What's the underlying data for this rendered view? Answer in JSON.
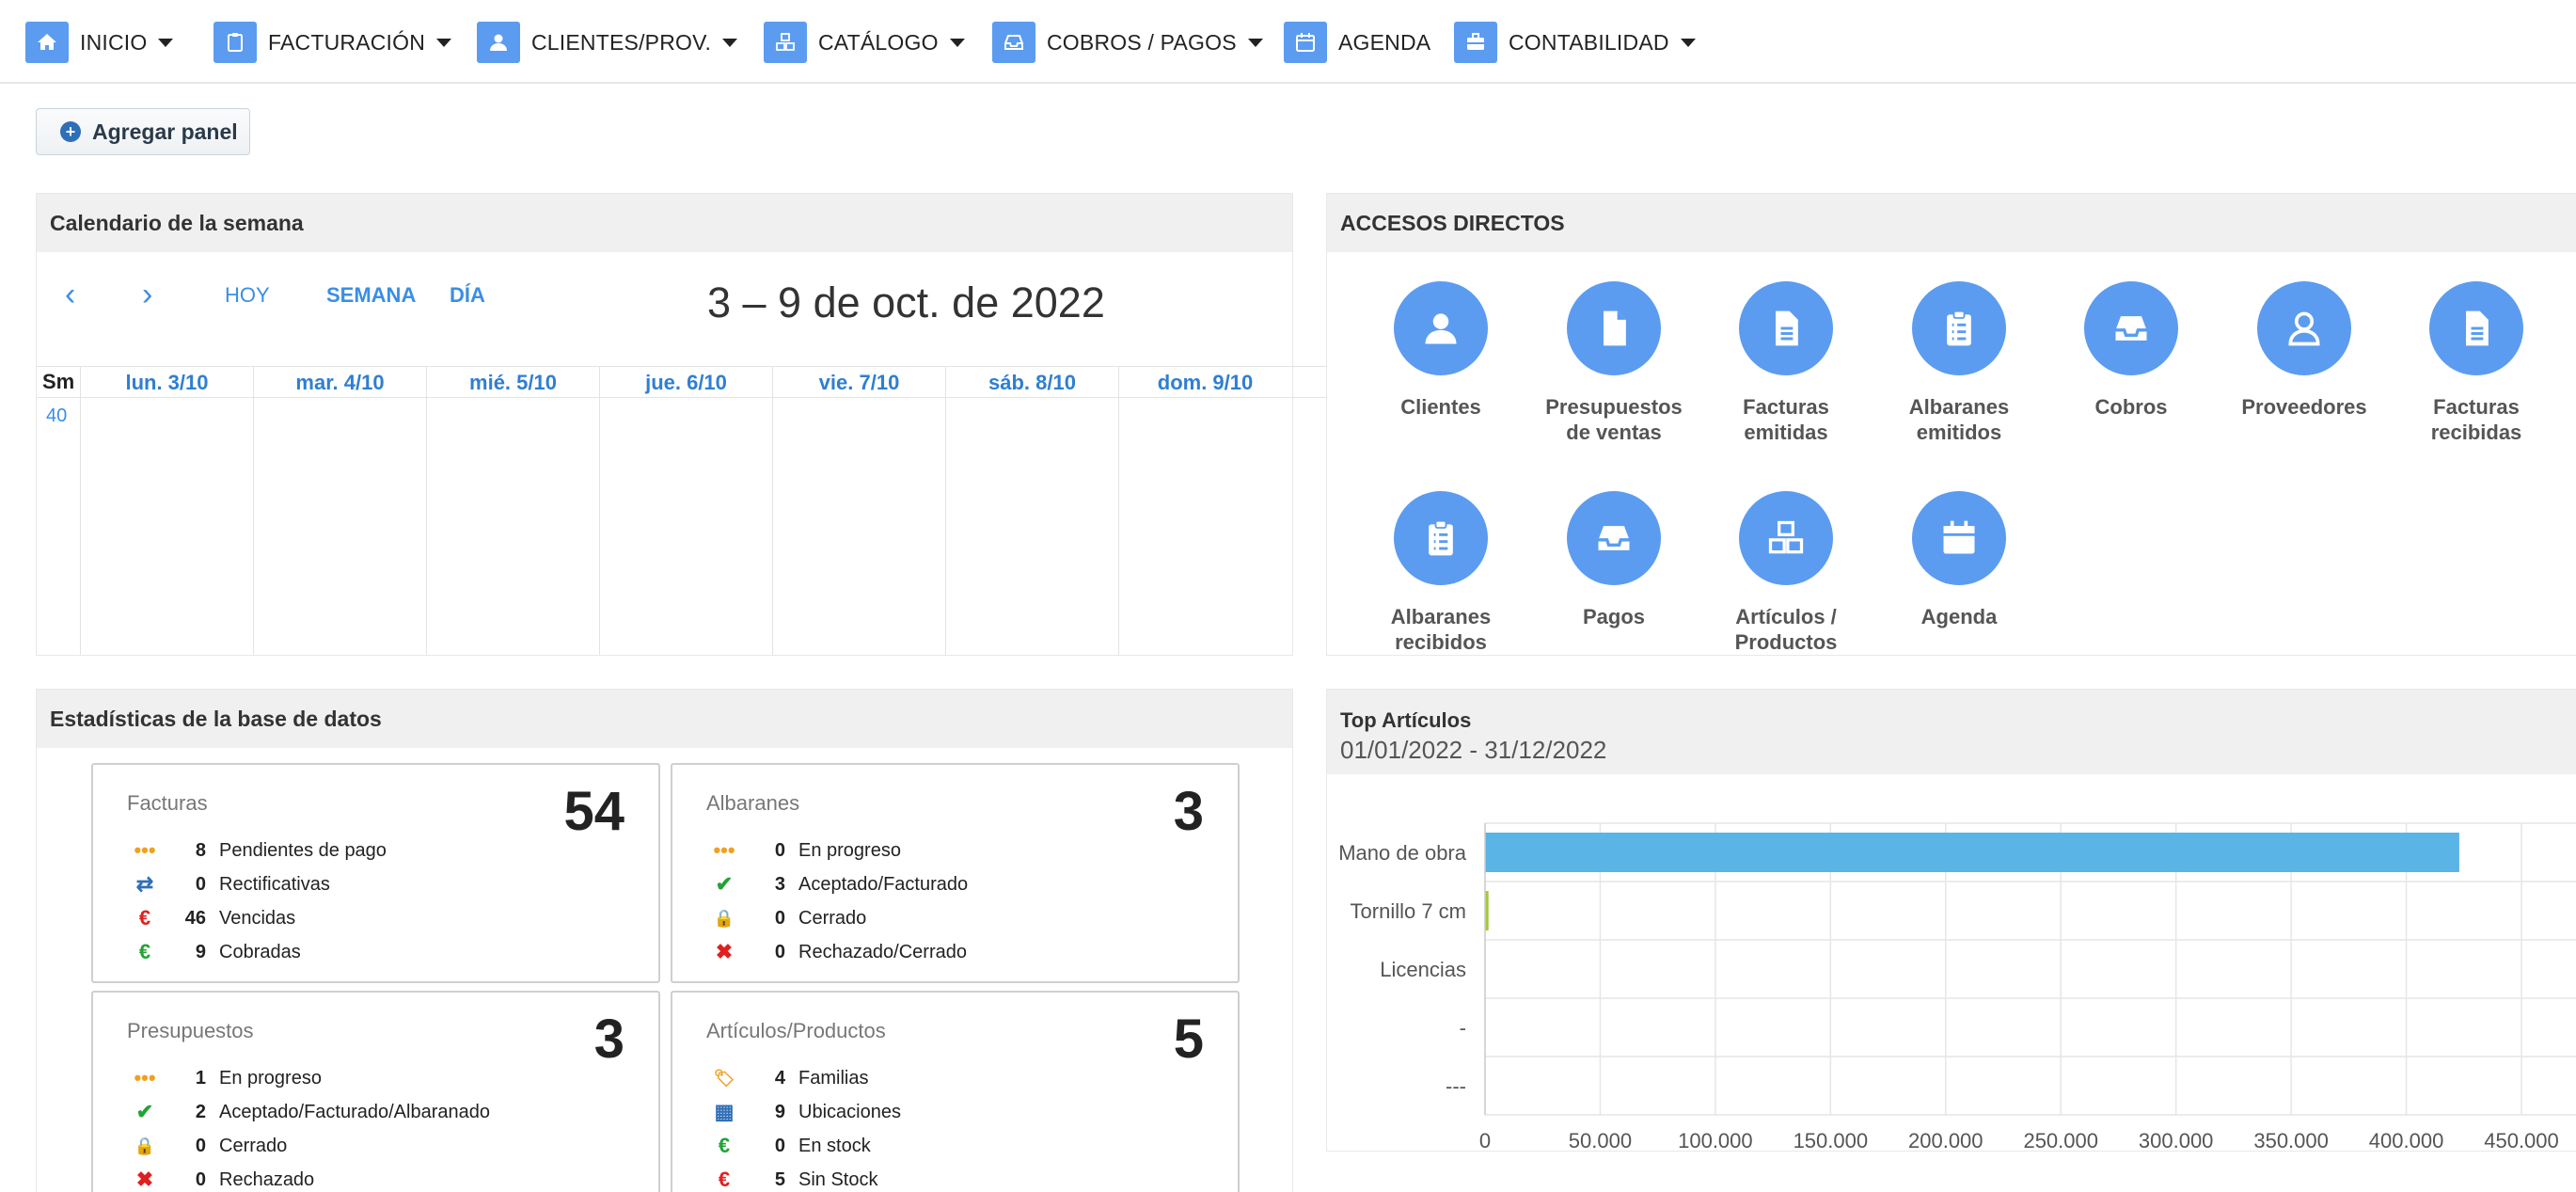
{
  "nav": {
    "items": [
      {
        "label": "INICIO",
        "icon": "home-icon",
        "caret": true
      },
      {
        "label": "FACTURACIÓN",
        "icon": "clipboard-icon",
        "caret": true
      },
      {
        "label": "CLIENTES/PROV.",
        "icon": "user-icon",
        "caret": true
      },
      {
        "label": "CATÁLOGO",
        "icon": "cubes-icon",
        "caret": true
      },
      {
        "label": "COBROS / PAGOS",
        "icon": "inbox-icon",
        "caret": true
      },
      {
        "label": "AGENDA",
        "icon": "calendar-icon",
        "caret": false
      },
      {
        "label": "CONTABILIDAD",
        "icon": "briefcase-icon",
        "caret": true
      }
    ],
    "accent": "#5b9cf0"
  },
  "toolbar": {
    "add_panel_label": "Agregar panel"
  },
  "calendar": {
    "title": "Calendario de la semana",
    "prev": "‹",
    "next": "›",
    "today": "HOY",
    "week": "SEMANA",
    "day": "DÍA",
    "range": "3 – 9 de oct. de 2022",
    "week_header": "Sm",
    "week_number": "40",
    "days": [
      "lun. 3/10",
      "mar. 4/10",
      "mié. 5/10",
      "jue. 6/10",
      "vie. 7/10",
      "sáb. 8/10",
      "dom. 9/10"
    ]
  },
  "accesos": {
    "title": "ACCESOS DIRECTOS",
    "items": [
      {
        "label1": "Clientes",
        "label2": "",
        "icon": "user-icon"
      },
      {
        "label1": "Presupuestos",
        "label2": "de ventas",
        "icon": "file-icon"
      },
      {
        "label1": "Facturas",
        "label2": "emitidas",
        "icon": "file-text-icon"
      },
      {
        "label1": "Albaranes",
        "label2": "emitidos",
        "icon": "clipboard-list-icon"
      },
      {
        "label1": "Cobros",
        "label2": "",
        "icon": "inbox-icon"
      },
      {
        "label1": "Proveedores",
        "label2": "",
        "icon": "user-outline-icon"
      },
      {
        "label1": "Facturas",
        "label2": "recibidas",
        "icon": "file-text-icon"
      },
      {
        "label1": "Albaranes",
        "label2": "recibidos",
        "icon": "clipboard-list-icon"
      },
      {
        "label1": "Pagos",
        "label2": "",
        "icon": "inbox-icon"
      },
      {
        "label1": "Artículos /",
        "label2": "Productos",
        "icon": "cubes-icon"
      },
      {
        "label1": "Agenda",
        "label2": "",
        "icon": "calendar-icon"
      }
    ]
  },
  "stats": {
    "title": "Estadísticas de la base de datos",
    "cards": [
      {
        "title": "Facturas",
        "total": "54",
        "rows": [
          {
            "icon": "ellipsis-icon",
            "glyph": "•••",
            "color": "#f0a020",
            "n": "8",
            "label": "Pendientes de pago"
          },
          {
            "icon": "exchange-icon",
            "glyph": "⇄",
            "color": "#2f6fb8",
            "n": "0",
            "label": "Rectificativas"
          },
          {
            "icon": "euro-icon",
            "glyph": "€",
            "color": "#e02020",
            "n": "46",
            "label": "Vencidas"
          },
          {
            "icon": "euro-icon",
            "glyph": "€",
            "color": "#22a335",
            "n": "9",
            "label": "Cobradas"
          }
        ]
      },
      {
        "title": "Albaranes",
        "total": "3",
        "rows": [
          {
            "icon": "ellipsis-icon",
            "glyph": "•••",
            "color": "#f0a020",
            "n": "0",
            "label": "En progreso"
          },
          {
            "icon": "check-icon",
            "glyph": "✔",
            "color": "#22a335",
            "n": "3",
            "label": "Aceptado/Facturado"
          },
          {
            "icon": "lock-icon",
            "glyph": "🔒",
            "color": "#2f6fb8",
            "n": "0",
            "label": "Cerrado"
          },
          {
            "icon": "times-icon",
            "glyph": "✖",
            "color": "#e02020",
            "n": "0",
            "label": "Rechazado/Cerrado"
          }
        ]
      },
      {
        "title": "Presupuestos",
        "total": "3",
        "rows": [
          {
            "icon": "ellipsis-icon",
            "glyph": "•••",
            "color": "#f0a020",
            "n": "1",
            "label": "En progreso"
          },
          {
            "icon": "check-icon",
            "glyph": "✔",
            "color": "#22a335",
            "n": "2",
            "label": "Aceptado/Facturado/Albaranado"
          },
          {
            "icon": "lock-icon",
            "glyph": "🔒",
            "color": "#2f6fb8",
            "n": "0",
            "label": "Cerrado"
          },
          {
            "icon": "times-icon",
            "glyph": "✖",
            "color": "#e02020",
            "n": "0",
            "label": "Rechazado"
          }
        ]
      },
      {
        "title": "Artículos/Productos",
        "total": "5",
        "rows": [
          {
            "icon": "tag-icon",
            "glyph": "🏷",
            "color": "#f0a020",
            "n": "4",
            "label": "Familias"
          },
          {
            "icon": "cubes-icon",
            "glyph": "▦",
            "color": "#2f6fb8",
            "n": "9",
            "label": "Ubicaciones"
          },
          {
            "icon": "euro-icon",
            "glyph": "€",
            "color": "#22a335",
            "n": "0",
            "label": "En stock"
          },
          {
            "icon": "euro-icon",
            "glyph": "€",
            "color": "#e02020",
            "n": "5",
            "label": "Sin Stock"
          }
        ]
      }
    ]
  },
  "top_articulos": {
    "title": "Top Artículos",
    "range": "01/01/2022 - 31/12/2022"
  },
  "chart_data": {
    "type": "bar",
    "orientation": "horizontal",
    "title": "Top Artículos",
    "categories": [
      "Mano de obra",
      "Tornillo 7 cm",
      "Licencias",
      "-",
      "---"
    ],
    "values": [
      423000,
      1500,
      0,
      0,
      0
    ],
    "bar_colors": [
      "#5ab4e5",
      "#a3c93a",
      "#5ab4e5",
      "#5ab4e5",
      "#5ab4e5"
    ],
    "xlim": [
      0,
      450000
    ],
    "xticks": [
      "0",
      "50.000",
      "100.000",
      "150.000",
      "200.000",
      "250.000",
      "300.000",
      "350.000",
      "400.000",
      "450.000"
    ],
    "grid": true
  }
}
